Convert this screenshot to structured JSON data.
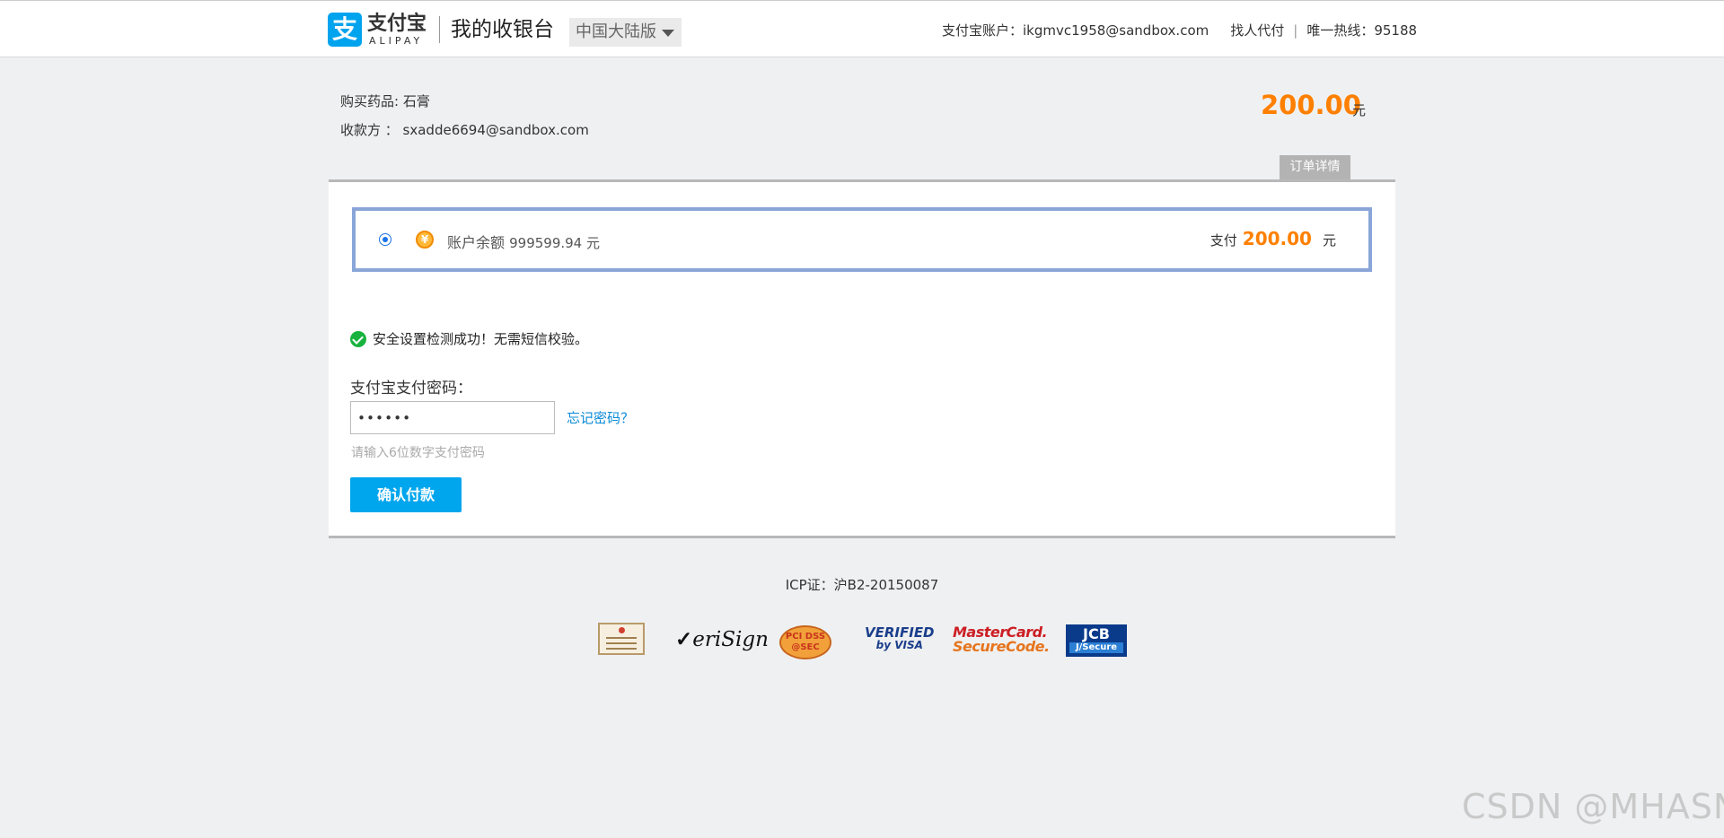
{
  "header": {
    "logo_char": "支",
    "logo_cn": "支付宝",
    "logo_en": "ALIPAY",
    "title": "我的收银台",
    "region": "中国大陆版",
    "account_label": "支付宝账户：ikgmvc1958@sandbox.com",
    "proxy_pay": "找人代付",
    "separator": "|",
    "hotline": "唯一热线：95188"
  },
  "order": {
    "product_line": "购买药品: 石膏",
    "payee_line": "收款方 ： sxadde6694@sandbox.com",
    "amount": "200.00",
    "unit": "元",
    "detail_tab": "订单详情"
  },
  "payment": {
    "yen_symbol": "¥",
    "balance_label": "账户余额",
    "balance_value": "999599.94 元",
    "pay_prefix": "支付",
    "pay_amount": "200.00",
    "pay_unit": "元"
  },
  "security": {
    "message": "安全设置检测成功！无需短信校验。"
  },
  "password": {
    "label": "支付宝支付密码：",
    "value": "••••••",
    "forgot_link": "忘记密码？",
    "hint": "请输入6位数字支付密码"
  },
  "confirm_button": "确认付款",
  "footer": {
    "icp": "ICP证：沪B2-20150087",
    "certs": {
      "verisign_tick": "✓",
      "verisign": "eriSign",
      "pci_top": "PCI DSS",
      "pci_bottom": "@SEC",
      "visa_top": "VERIFIED",
      "visa_bottom": "by VISA",
      "mc_top": "MasterCard.",
      "mc_bottom": "SecureCode.",
      "jcb_top": "JCB",
      "jcb_bottom": "J/Secure"
    }
  },
  "watermark": "CSDN @MHASNQ",
  "colors": {
    "brand_blue": "#00a3ee",
    "amount_orange": "#ff8000",
    "method_border": "#8aa6d8",
    "success_green": "#18b33e",
    "link_blue": "#0a8ad6"
  }
}
